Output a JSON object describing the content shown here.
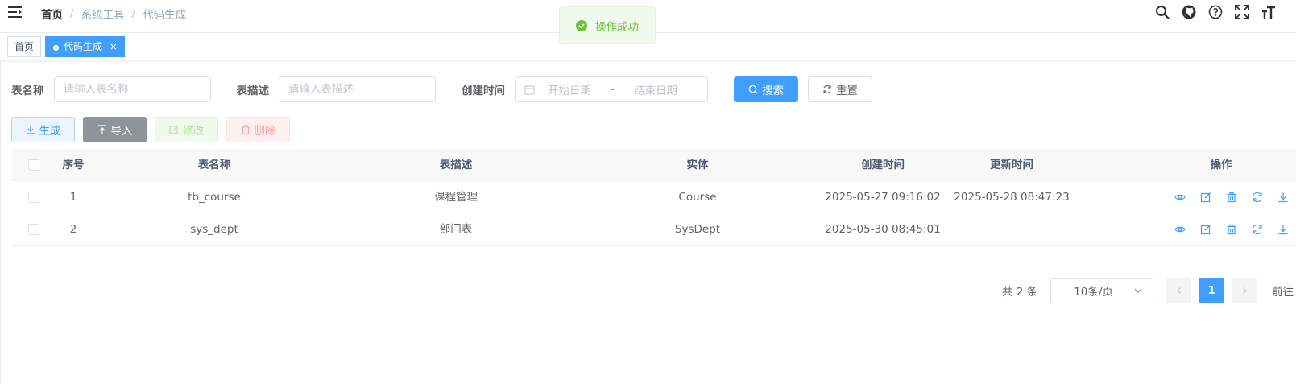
{
  "navbar": {
    "breadcrumb": [
      "首页",
      "系统工具",
      "代码生成"
    ],
    "separator": "/",
    "icons": [
      "search-icon",
      "github-icon",
      "question-icon",
      "fullscreen-icon",
      "font-size-icon"
    ]
  },
  "toast": {
    "message": "操作成功",
    "color": "#67c23a"
  },
  "tags": {
    "home": "首页",
    "active": "代码生成",
    "close": "×"
  },
  "search": {
    "table_name_label": "表名称",
    "table_name_placeholder": "请输入表名称",
    "table_desc_label": "表描述",
    "table_desc_placeholder": "请输入表描述",
    "create_time_label": "创建时间",
    "start_placeholder": "开始日期",
    "range_separator": "-",
    "end_placeholder": "结束日期",
    "search_button": "搜索",
    "reset_button": "重置"
  },
  "toolbar": {
    "generate": "生成",
    "import": "导入",
    "edit": "修改",
    "delete": "删除"
  },
  "table": {
    "headers": {
      "index": "序号",
      "table_name": "表名称",
      "table_desc": "表描述",
      "entity": "实体",
      "create_time": "创建时间",
      "update_time": "更新时间",
      "ops": "操作"
    },
    "rows": [
      {
        "index": "1",
        "table_name": "tb_course",
        "table_desc": "课程管理",
        "entity": "Course",
        "create_time": "2025-05-27 09:16:02",
        "update_time": "2025-05-28 08:47:23"
      },
      {
        "index": "2",
        "table_name": "sys_dept",
        "table_desc": "部门表",
        "entity": "SysDept",
        "create_time": "2025-05-30 08:45:01",
        "update_time": ""
      }
    ],
    "row_actions": [
      "preview-icon",
      "edit-icon",
      "delete-icon",
      "sync-icon",
      "download-icon"
    ]
  },
  "pagination": {
    "total": "共 2 条",
    "page_size": "10条/页",
    "current": "1",
    "goto": "前往"
  },
  "colors": {
    "primary": "#409eff",
    "success": "#67c23a",
    "info": "#909399",
    "danger": "#f56c6c"
  }
}
